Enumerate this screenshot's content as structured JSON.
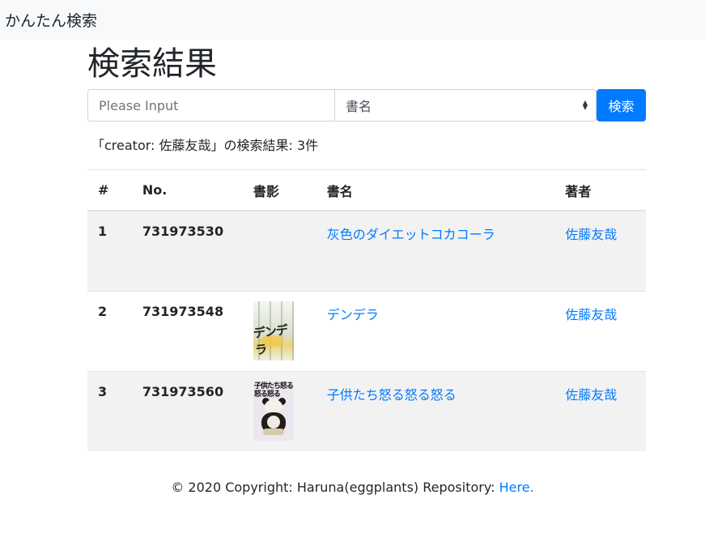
{
  "navbar": {
    "brand": "かんたん検索"
  },
  "page": {
    "title": "検索結果"
  },
  "search": {
    "placeholder": "Please Input",
    "value": "",
    "field_selected": "書名",
    "submit_label": "検索"
  },
  "summary": "「creator: 佐藤友哉」の検索結果: 3件",
  "table": {
    "headers": {
      "index": "#",
      "no": "No.",
      "cover": "書影",
      "title": "書名",
      "author": "著者"
    },
    "rows": [
      {
        "index": "1",
        "no": "731973530",
        "title": "灰色のダイエットコカコーラ",
        "author": "佐藤友哉",
        "has_cover": false
      },
      {
        "index": "2",
        "no": "731973548",
        "title": "デンデラ",
        "author": "佐藤友哉",
        "has_cover": true,
        "cover_text": "デンデラ"
      },
      {
        "index": "3",
        "no": "731973560",
        "title": "子供たち怒る怒る怒る",
        "author": "佐藤友哉",
        "has_cover": true,
        "cover_text": "子供たち怒る怒る怒る"
      }
    ]
  },
  "footer": {
    "text": "© 2020 Copyright: Haruna(eggplants) Repository: ",
    "link_label": "Here."
  },
  "colors": {
    "accent": "#007bff",
    "navbar_bg": "#f8f9fa",
    "stripe_bg": "#f2f2f2"
  }
}
